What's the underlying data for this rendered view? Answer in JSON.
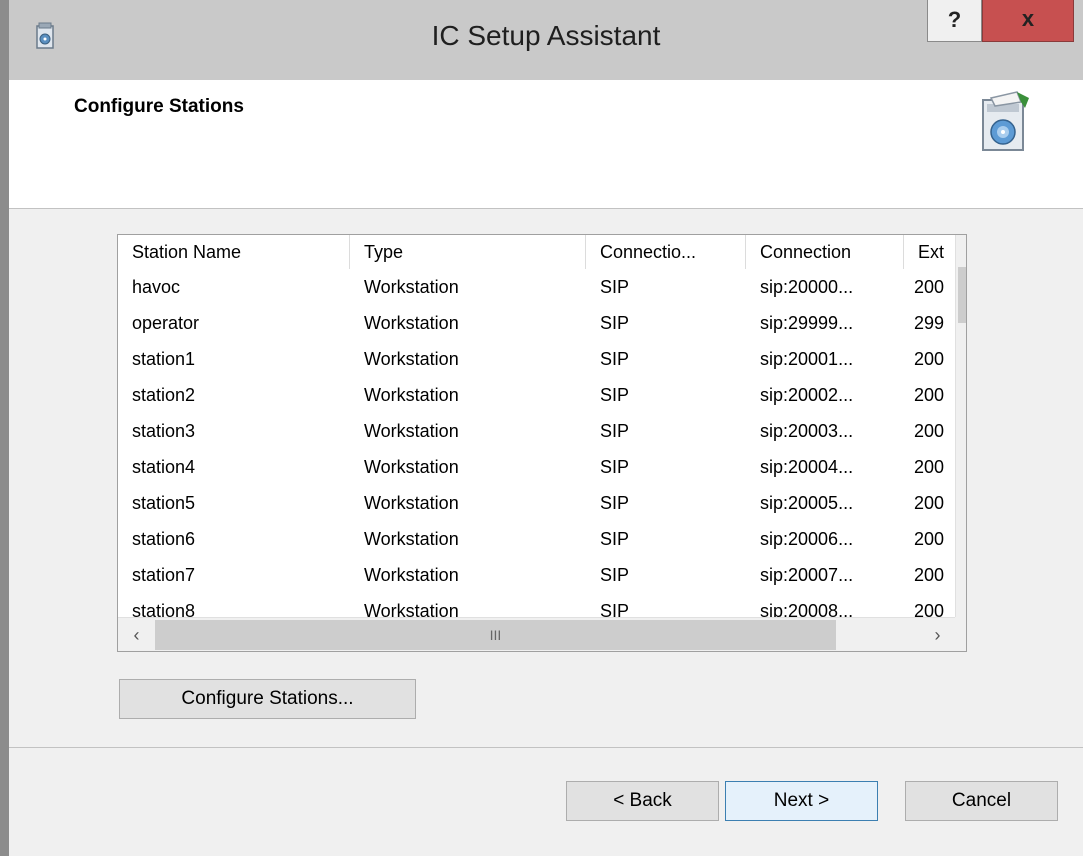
{
  "window": {
    "title": "IC Setup Assistant",
    "help_label": "?",
    "close_label": "x"
  },
  "header": {
    "title": "Configure Stations"
  },
  "table": {
    "columns": [
      "Station Name",
      "Type",
      "Connectio...",
      "Connection",
      "Ext"
    ],
    "rows": [
      [
        "havoc",
        "Workstation",
        "SIP",
        "sip:20000...",
        "200"
      ],
      [
        "operator",
        "Workstation",
        "SIP",
        "sip:29999...",
        "299"
      ],
      [
        "station1",
        "Workstation",
        "SIP",
        "sip:20001...",
        "200"
      ],
      [
        "station2",
        "Workstation",
        "SIP",
        "sip:20002...",
        "200"
      ],
      [
        "station3",
        "Workstation",
        "SIP",
        "sip:20003...",
        "200"
      ],
      [
        "station4",
        "Workstation",
        "SIP",
        "sip:20004...",
        "200"
      ],
      [
        "station5",
        "Workstation",
        "SIP",
        "sip:20005...",
        "200"
      ],
      [
        "station6",
        "Workstation",
        "SIP",
        "sip:20006...",
        "200"
      ],
      [
        "station7",
        "Workstation",
        "SIP",
        "sip:20007...",
        "200"
      ],
      [
        "station8",
        "Workstation",
        "SIP",
        "sip:20008...",
        "200"
      ]
    ]
  },
  "configure_button": "Configure Stations...",
  "footer": {
    "back": "< Back",
    "next": "Next >",
    "cancel": "Cancel"
  },
  "colors": {
    "close_button": "#c75050",
    "content_bg": "#f0f0f0",
    "window_frame": "#c9c9c9"
  }
}
